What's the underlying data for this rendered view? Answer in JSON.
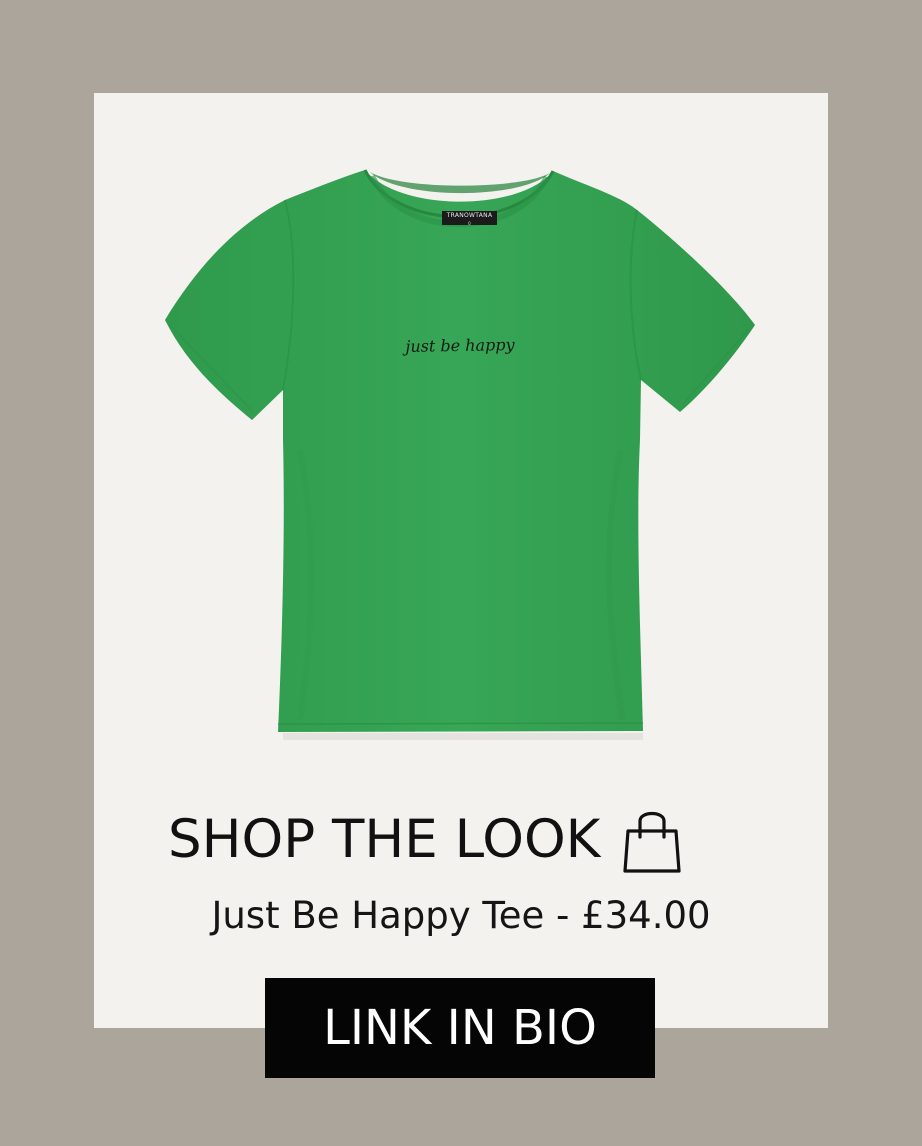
{
  "product": {
    "image_alt": "green t-shirt",
    "color": "#33a152",
    "brand_label": "TRANOWTANA",
    "size_label": "0",
    "print_text": "just be happy"
  },
  "headline": {
    "text": "SHOP THE LOOK",
    "icon": "shopping-bag-icon"
  },
  "subline": {
    "text": "Just Be Happy Tee - £34.00"
  },
  "cta": {
    "label": "LINK IN BIO"
  },
  "colors": {
    "background": "#aca59b",
    "card": "#f3f2ef",
    "cta_background": "#050505",
    "cta_text": "#ffffff"
  }
}
